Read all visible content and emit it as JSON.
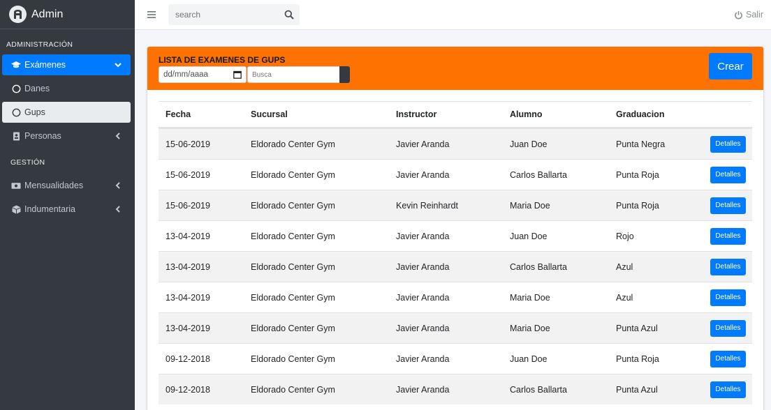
{
  "brand": {
    "name": "Admin",
    "logo_icon": "brand-logo-icon"
  },
  "sidebar": {
    "header_admin": "ADMINISTRACIÓN",
    "header_gestion": "GESTIÓN",
    "items": [
      {
        "label": "Exámenes",
        "icon": "graduation-cap-icon",
        "state": "active"
      },
      {
        "label": "Danes",
        "icon": "circle-icon"
      },
      {
        "label": "Gups",
        "icon": "circle-icon",
        "state": "selected"
      },
      {
        "label": "Personas",
        "icon": "id-card-icon"
      },
      {
        "label": "Mensualidades",
        "icon": "money-bill-icon"
      },
      {
        "label": "Indumentaria",
        "icon": "box-icon"
      }
    ]
  },
  "topbar": {
    "search_placeholder": "search",
    "logout_label": "Salir"
  },
  "card": {
    "title": "LISTA DE EXAMENES DE GUPS",
    "date_placeholder": "dd/mm/aaaa",
    "busca_placeholder": "Busca",
    "crear_label": "Crear"
  },
  "table": {
    "headers": [
      "Fecha",
      "Sucursal",
      "Instructor",
      "Alumno",
      "Graduacion"
    ],
    "action_label": "Detalles",
    "rows": [
      [
        "15-06-2019",
        "Eldorado Center Gym",
        "Javier Aranda",
        "Juan Doe",
        "Punta Negra"
      ],
      [
        "15-06-2019",
        "Eldorado Center Gym",
        "Javier Aranda",
        "Carlos Ballarta",
        "Punta Roja"
      ],
      [
        "15-06-2019",
        "Eldorado Center Gym",
        "Kevin Reinhardt",
        "Maria Doe",
        "Punta Roja"
      ],
      [
        "13-04-2019",
        "Eldorado Center Gym",
        "Javier Aranda",
        "Juan Doe",
        "Rojo"
      ],
      [
        "13-04-2019",
        "Eldorado Center Gym",
        "Javier Aranda",
        "Carlos Ballarta",
        "Azul"
      ],
      [
        "13-04-2019",
        "Eldorado Center Gym",
        "Javier Aranda",
        "Maria Doe",
        "Azul"
      ],
      [
        "13-04-2019",
        "Eldorado Center Gym",
        "Javier Aranda",
        "Maria Doe",
        "Punta Azul"
      ],
      [
        "09-12-2018",
        "Eldorado Center Gym",
        "Javier Aranda",
        "Juan Doe",
        "Punta Roja"
      ],
      [
        "09-12-2018",
        "Eldorado Center Gym",
        "Javier Aranda",
        "Carlos Ballarta",
        "Punta Azul"
      ]
    ]
  },
  "colors": {
    "sidebar_bg": "#343a40",
    "accent": "#007bff",
    "header_orange": "#fd7200"
  }
}
